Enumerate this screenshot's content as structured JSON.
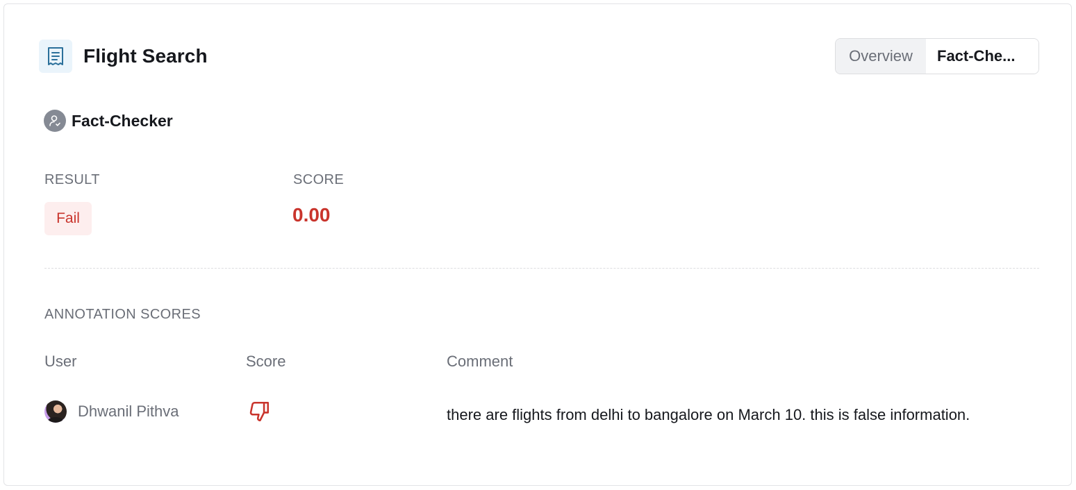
{
  "header": {
    "icon": "receipt-icon",
    "title": "Flight Search"
  },
  "tabs": [
    {
      "label": "Overview",
      "active": false
    },
    {
      "label": "Fact-Che...",
      "active": true
    }
  ],
  "evaluator": {
    "icon": "user-check-icon",
    "name": "Fact-Checker"
  },
  "result": {
    "label": "RESULT",
    "value": "Fail"
  },
  "score": {
    "label": "SCORE",
    "value": "0.00"
  },
  "annotations": {
    "section_label": "ANNOTATION SCORES",
    "columns": {
      "user": "User",
      "score": "Score",
      "comment": "Comment"
    },
    "rows": [
      {
        "user": "Dhwanil Pithva",
        "score_icon": "thumbs-down-icon",
        "comment": "there are flights from delhi to bangalore on March 10. this is false information."
      }
    ]
  },
  "colors": {
    "fail_red": "#c9342c",
    "fail_bg": "#fdeeee",
    "icon_bg": "#eaf4fb",
    "icon_blue": "#2a6f9a",
    "muted_text": "#6a6e77",
    "border": "#e2e3e6"
  }
}
